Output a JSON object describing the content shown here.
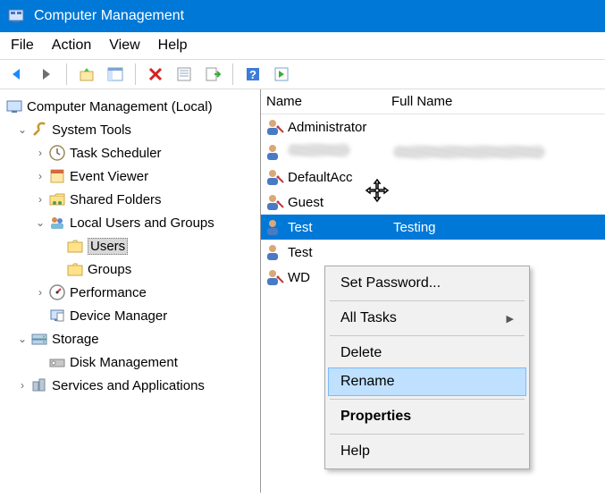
{
  "window": {
    "title": "Computer Management"
  },
  "menubar": {
    "file": "File",
    "action": "Action",
    "view": "View",
    "help": "Help"
  },
  "tree": {
    "root": "Computer Management (Local)",
    "system_tools": "System Tools",
    "task_scheduler": "Task Scheduler",
    "event_viewer": "Event Viewer",
    "shared_folders": "Shared Folders",
    "local_users": "Local Users and Groups",
    "users": "Users",
    "groups": "Groups",
    "performance": "Performance",
    "device_manager": "Device Manager",
    "storage": "Storage",
    "disk_management": "Disk Management",
    "services_apps": "Services and Applications"
  },
  "list": {
    "header_name": "Name",
    "header_fullname": "Full Name",
    "rows": {
      "admin": "Administrator",
      "default": "DefaultAcc",
      "guest": "Guest",
      "test": "Test",
      "test_full": "Testing",
      "test2": "Test",
      "wd": "WD"
    }
  },
  "contextmenu": {
    "set_password": "Set Password...",
    "all_tasks": "All Tasks",
    "delete": "Delete",
    "rename": "Rename",
    "properties": "Properties",
    "help": "Help"
  }
}
